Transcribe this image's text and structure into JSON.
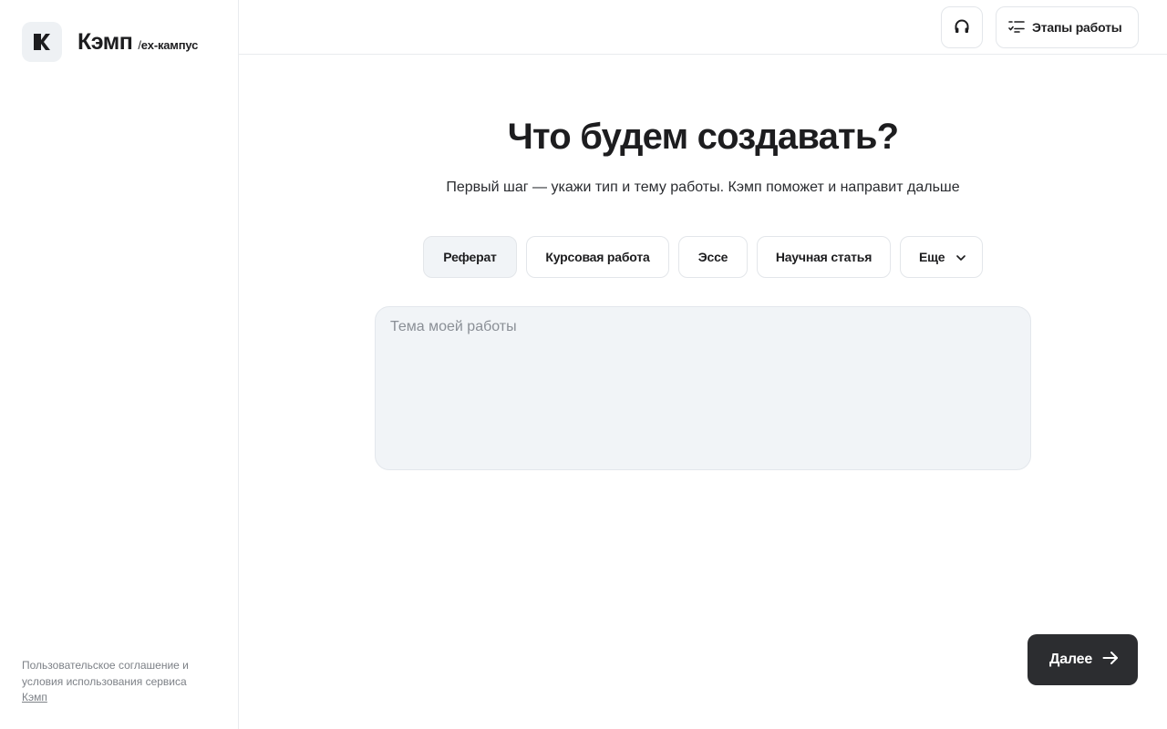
{
  "brand": {
    "name": "Кэмп",
    "sub_slash": "/",
    "sub": "ex-кампус",
    "logo_icon": "k-logo-icon"
  },
  "sidebar": {
    "footer_text": "Пользовательское соглашение и условия использования сервиса",
    "footer_link": "Кэмп"
  },
  "topbar": {
    "support_icon": "headphones-icon",
    "stages_icon": "checklist-icon",
    "stages_label": "Этапы работы"
  },
  "main": {
    "title": "Что будем создавать?",
    "subtitle": "Первый шаг — укажи тип и тему работы. Кэмп поможет и направит дальше",
    "work_types": [
      {
        "label": "Реферат",
        "selected": true
      },
      {
        "label": "Курсовая работа",
        "selected": false
      },
      {
        "label": "Эссе",
        "selected": false
      },
      {
        "label": "Научная статья",
        "selected": false
      }
    ],
    "more_label": "Еще",
    "topic_placeholder": "Тема моей работы",
    "topic_value": ""
  },
  "footer": {
    "next_label": "Далее",
    "next_icon": "arrow-right-icon"
  },
  "colors": {
    "accent_dark": "#2c2d30",
    "chip_selected_bg": "#f1f4f7",
    "border": "#e3e6ea"
  }
}
